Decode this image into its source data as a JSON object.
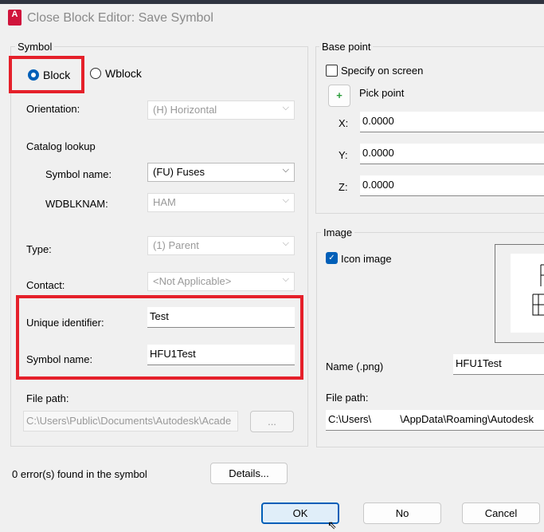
{
  "window": {
    "title": "Close Block Editor: Save Symbol",
    "app_icon": "A"
  },
  "symbol": {
    "group": "Symbol",
    "block": "Block",
    "wblock": "Wblock",
    "selected": "Block",
    "orientation_label": "Orientation:",
    "orientation": "(H) Horizontal",
    "catalog_lookup": "Catalog lookup",
    "symbol_name_label": "Symbol name:",
    "symbol_name": "(FU) Fuses",
    "wdblknam_label": "WDBLKNAM:",
    "wdblknam": "HAM",
    "type_label": "Type:",
    "type": "(1) Parent",
    "contact_label": "Contact:",
    "contact": "<Not Applicable>",
    "unique_id_label": "Unique identifier:",
    "unique_id": "Test",
    "block_name_label": "Symbol name:",
    "block_name": "HFU1Test",
    "file_path_label": "File path:",
    "file_path": "C:\\Users\\Public\\Documents\\Autodesk\\Acade",
    "browse": "..."
  },
  "base_point": {
    "group": "Base point",
    "specify": "Specify on screen",
    "pick": "Pick point",
    "x_label": "X:",
    "x": "0.0000",
    "y_label": "Y:",
    "y": "0.0000",
    "z_label": "Z:",
    "z": "0.0000"
  },
  "image": {
    "group": "Image",
    "icon_image": "Icon image",
    "name_label": "Name (.png)",
    "name": "HFU1Test",
    "file_path_label": "File path:",
    "file_path": "C:\\Users\\          \\AppData\\Roaming\\Autodesk"
  },
  "footer": {
    "errors": "0 error(s) found in the symbol",
    "details": "Details...",
    "ok": "OK",
    "no": "No",
    "cancel": "Cancel"
  },
  "colors": {
    "highlight": "#e5202a",
    "accent": "#005fb8"
  }
}
